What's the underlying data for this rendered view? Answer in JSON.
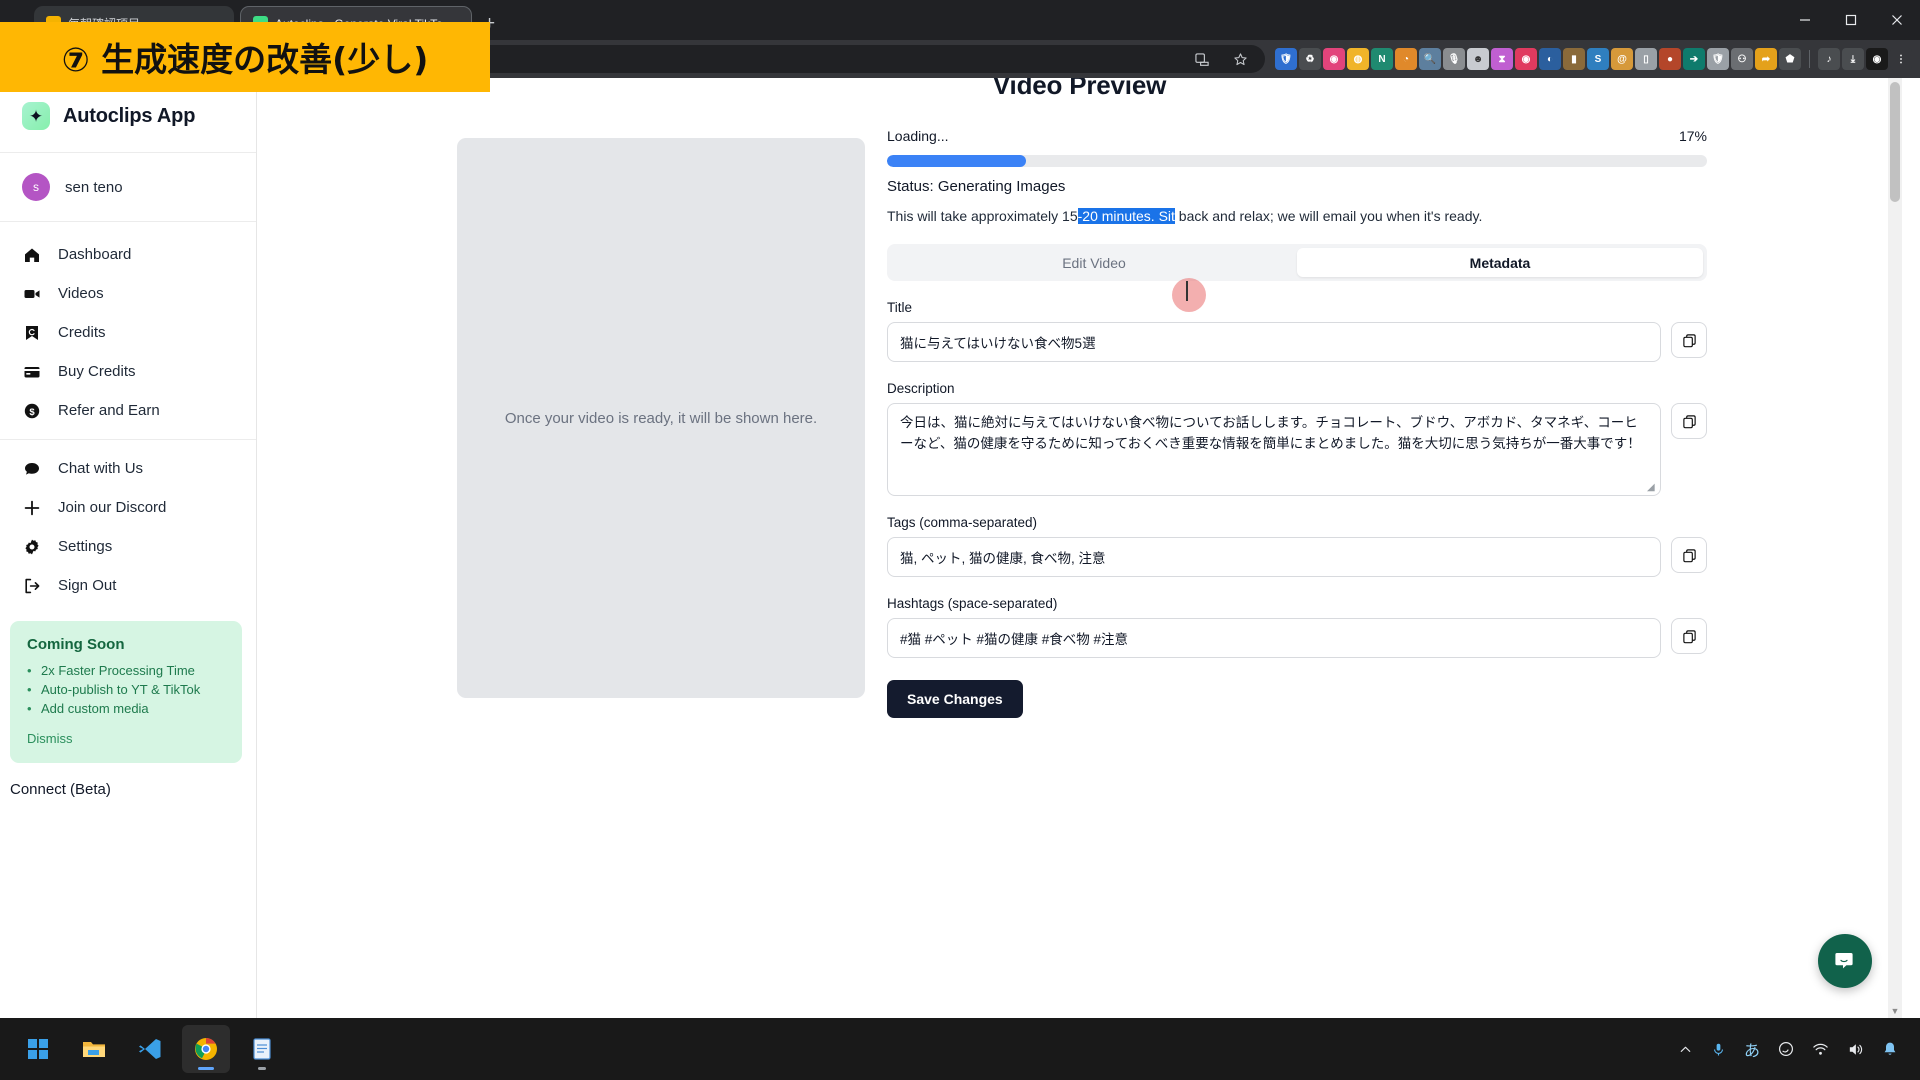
{
  "browser": {
    "tabs": [
      {
        "label": "毎朝確認項目",
        "active": false
      },
      {
        "label": "Autoclips - Generate Viral TikTo...",
        "active": true
      }
    ],
    "new_tab_label": "+",
    "omnibox_value": "",
    "window_controls": {
      "minimize": "minimize-icon",
      "maximize": "maximize-icon",
      "close": "close-icon"
    },
    "toolbar_icons": [
      "back-icon",
      "forward-icon",
      "reload-icon",
      "home-icon"
    ],
    "extension_colors": [
      "#2f6fd0",
      "#9aa0a6",
      "#e23b6e",
      "#f0b429",
      "#1f8a70",
      "#e0892a",
      "#6aa3e0",
      "#cfd2d5",
      "#d9dde1",
      "#c05fd1",
      "#e03a5f",
      "#2b5f9e",
      "#c9923a",
      "#2f7fbf",
      "#d6993a",
      "#c7c7c7",
      "#b4462a",
      "#0f7b6c",
      "#9aa0a6",
      "#e4a11b"
    ]
  },
  "overlay": {
    "banner_text": "⑦ 生成速度の改善(少し)",
    "banner_bg": "#ffb703"
  },
  "sidebar": {
    "brand": {
      "name": "Autoclips App",
      "icon": "sparkle-icon"
    },
    "user": {
      "initial": "s",
      "name": "sen teno",
      "avatar_color": "#b455c4"
    },
    "nav_items": [
      {
        "label": "Dashboard",
        "icon": "home-icon"
      },
      {
        "label": "Videos",
        "icon": "video-camera-icon"
      },
      {
        "label": "Credits",
        "icon": "credits-icon"
      },
      {
        "label": "Buy Credits",
        "icon": "credit-card-icon"
      },
      {
        "label": "Refer and Earn",
        "icon": "dollar-circle-icon"
      }
    ],
    "nav_items_secondary": [
      {
        "label": "Chat with Us",
        "icon": "chat-bubble-icon"
      },
      {
        "label": "Join our Discord",
        "icon": "plus-icon"
      },
      {
        "label": "Settings",
        "icon": "gear-icon"
      },
      {
        "label": "Sign Out",
        "icon": "sign-out-icon"
      }
    ],
    "promo": {
      "title": "Coming Soon",
      "items": [
        "2x Faster Processing Time",
        "Auto-publish to YT & TikTok",
        "Add custom media"
      ],
      "dismiss_label": "Dismiss",
      "bg": "#d6f5e3",
      "text_color": "#15613c"
    },
    "connect_label": "Connect (Beta)"
  },
  "main": {
    "page_title": "Video Preview",
    "preview_placeholder": "Once your video is ready, it will be shown here.",
    "progress": {
      "loading_label": "Loading...",
      "percent_label": "17%",
      "percent_value": 17,
      "fill_color": "#3b82f6"
    },
    "status_text": "Status: Generating Images",
    "hint": {
      "before": "This will take approximately 15",
      "selected": "-20 minutes. Sit",
      "after": " back and relax; we will email you when it's ready."
    },
    "tabs": [
      {
        "label": "Edit Video",
        "active": false
      },
      {
        "label": "Metadata",
        "active": true
      }
    ],
    "fields": {
      "title": {
        "label": "Title",
        "value": "猫に与えてはいけない食べ物5選",
        "copy_icon": "copy-icon"
      },
      "description": {
        "label": "Description",
        "value": "今日は、猫に絶対に与えてはいけない食べ物についてお話しします。チョコレート、ブドウ、アボカド、タマネギ、コーヒーなど、猫の健康を守るために知っておくべき重要な情報を簡単にまとめました。猫を大切に思う気持ちが一番大事です！",
        "copy_icon": "copy-icon"
      },
      "tags": {
        "label": "Tags (comma-separated)",
        "value": "猫, ペット, 猫の健康, 食べ物, 注意",
        "copy_icon": "copy-icon"
      },
      "hashtags": {
        "label": "Hashtags (space-separated)",
        "value": "#猫 #ペット #猫の健康 #食べ物 #注意",
        "copy_icon": "copy-icon"
      }
    },
    "save_button_label": "Save Changes",
    "chat_fab": {
      "icon": "chat-smile-icon",
      "color": "#11624b"
    }
  },
  "taskbar": {
    "apps": [
      "start-icon",
      "file-explorer-icon",
      "vscode-icon",
      "chrome-icon",
      "notepad-icon"
    ],
    "tray": [
      "chevron-up-icon",
      "microphone-icon",
      "ime-japanese-icon",
      "ime-mode-icon",
      "wifi-icon",
      "volume-icon",
      "notification-bell-icon"
    ]
  }
}
